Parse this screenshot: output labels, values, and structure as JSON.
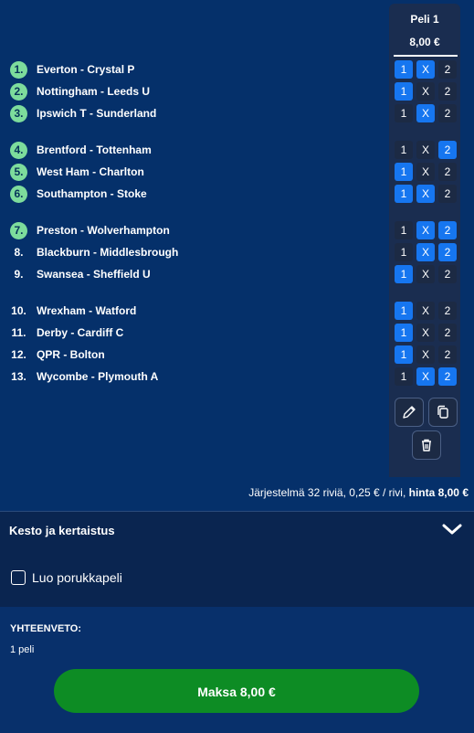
{
  "coupon": {
    "title": "Peli 1",
    "price": "8,00 €"
  },
  "matches": [
    {
      "num": "1.",
      "teams": "Everton - Crystal P",
      "picks": [
        "1",
        "X",
        "2"
      ],
      "sel": [
        true,
        true,
        false
      ]
    },
    {
      "num": "2.",
      "teams": "Nottingham - Leeds U",
      "picks": [
        "1",
        "X",
        "2"
      ],
      "sel": [
        true,
        false,
        false
      ]
    },
    {
      "num": "3.",
      "teams": "Ipswich T - Sunderland",
      "picks": [
        "1",
        "X",
        "2"
      ],
      "sel": [
        false,
        true,
        false
      ]
    },
    {
      "num": "4.",
      "teams": "Brentford - Tottenham",
      "picks": [
        "1",
        "X",
        "2"
      ],
      "sel": [
        false,
        false,
        true
      ]
    },
    {
      "num": "5.",
      "teams": "West Ham - Charlton",
      "picks": [
        "1",
        "X",
        "2"
      ],
      "sel": [
        true,
        false,
        false
      ]
    },
    {
      "num": "6.",
      "teams": "Southampton - Stoke",
      "picks": [
        "1",
        "X",
        "2"
      ],
      "sel": [
        true,
        true,
        false
      ]
    },
    {
      "num": "7.",
      "teams": "Preston - Wolverhampton",
      "picks": [
        "1",
        "X",
        "2"
      ],
      "sel": [
        false,
        true,
        true
      ]
    },
    {
      "num": "8.",
      "teams": "Blackburn - Middlesbrough",
      "picks": [
        "1",
        "X",
        "2"
      ],
      "sel": [
        false,
        true,
        true
      ]
    },
    {
      "num": "9.",
      "teams": "Swansea - Sheffield U",
      "picks": [
        "1",
        "X",
        "2"
      ],
      "sel": [
        true,
        false,
        false
      ]
    },
    {
      "num": "10.",
      "teams": "Wrexham - Watford",
      "picks": [
        "1",
        "X",
        "2"
      ],
      "sel": [
        true,
        false,
        false
      ]
    },
    {
      "num": "11.",
      "teams": "Derby - Cardiff C",
      "picks": [
        "1",
        "X",
        "2"
      ],
      "sel": [
        true,
        false,
        false
      ]
    },
    {
      "num": "12.",
      "teams": "QPR - Bolton",
      "picks": [
        "1",
        "X",
        "2"
      ],
      "sel": [
        true,
        false,
        false
      ]
    },
    {
      "num": "13.",
      "teams": "Wycombe - Plymouth A",
      "picks": [
        "1",
        "X",
        "2"
      ],
      "sel": [
        false,
        true,
        true
      ]
    }
  ],
  "green_badges": [
    true,
    true,
    true,
    true,
    true,
    true,
    true,
    false,
    false,
    false,
    false,
    false,
    false
  ],
  "actions": {
    "edit_icon": "pencil-icon",
    "copy_icon": "copy-icon",
    "delete_icon": "trash-icon"
  },
  "system_line": {
    "text": "Järjestelmä 32 riviä, 0,25 € / rivi, ",
    "price_label": "hinta 8,00 €"
  },
  "kesto": {
    "label": "Kesto ja kertaistus",
    "icon": "chevron-down-icon"
  },
  "porukka": {
    "label": "Luo porukkapeli",
    "checked": false
  },
  "summary": {
    "title": "YHTEENVETO:",
    "count": "1 peli"
  },
  "pay_button": {
    "label": "Maksa 8,00 €"
  },
  "colors": {
    "background": "#08306b",
    "selected_pick": "#1676f0",
    "unselected_pick": "#1c2a44",
    "green_badge": "#7ddc9c",
    "pay_button": "#0d8c24"
  }
}
